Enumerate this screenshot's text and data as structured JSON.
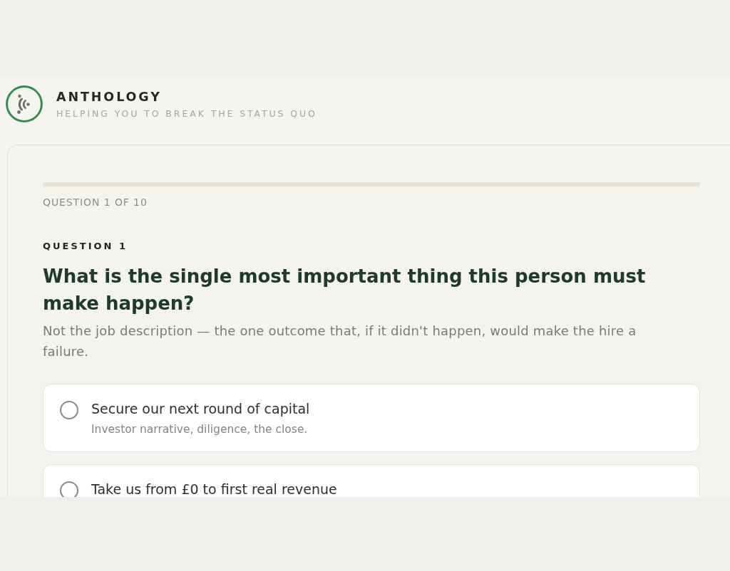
{
  "header": {
    "brand": "ANTHOLOGY",
    "tagline": "HELPING YOU TO BREAK THE STATUS QUO"
  },
  "quiz": {
    "counter": "QUESTION 1 OF 10",
    "question_label": "QUESTION 1",
    "question": "What is the single most important thing this person must make happen?",
    "hint": "Not the job description — the one outcome that, if it didn't happen, would make the hire a failure.",
    "options": [
      {
        "label": "Secure our next round of capital",
        "description": "Investor narrative, diligence, the close.",
        "selected": false
      },
      {
        "label": "Take us from £0 to first real revenue",
        "selected": false
      }
    ]
  }
}
